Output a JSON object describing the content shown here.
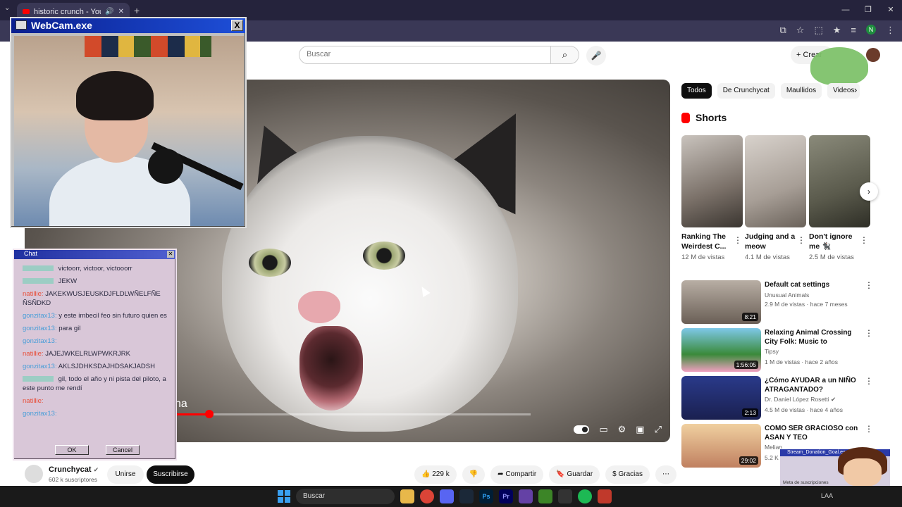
{
  "browser": {
    "tab_title": "historic crunch - YouTube",
    "new_tab": "+",
    "profile_initial": "N"
  },
  "youtube": {
    "search_placeholder": "Buscar",
    "create_label": "Crear",
    "overlay_text": "na",
    "channel": {
      "name": "Crunchycat",
      "subscribers": "602 k suscriptores",
      "join_label": "Unirse",
      "subscribe_label": "Suscribirse"
    },
    "actions": {
      "likes": "229 k",
      "share": "Compartir",
      "save": "Guardar",
      "thanks": "Gracias"
    },
    "chips": [
      "Todos",
      "De Crunchycat",
      "Maullidos",
      "Videos"
    ],
    "shorts_header": "Shorts",
    "shorts": [
      {
        "title": "Ranking The Weirdest C...",
        "views": "12 M de vistas"
      },
      {
        "title": "Judging and a meow",
        "views": "4.1 M de vistas"
      },
      {
        "title": "Don't ignore me 🐈‍⬛",
        "views": "2.5 M de vistas"
      }
    ],
    "recommendations": [
      {
        "title": "Default cat settings",
        "channel": "Unusual Animals",
        "meta": "2.9 M de vistas · hace 7 meses",
        "duration": "8:21"
      },
      {
        "title": "Relaxing Animal Crossing City Folk: Music to study/chill/rela...",
        "channel": "Tipsy",
        "meta": "1 M de vistas · hace 2 años",
        "duration": "1:56:05"
      },
      {
        "title": "¿Cómo AYUDAR a un NIÑO ATRAGANTADO?",
        "channel": "Dr. Daniel López Rosetti",
        "meta": "4.5 M de vistas · hace 4 años",
        "duration": "2:13"
      },
      {
        "title": "COMO SER GRACIOSO con ASAN Y TEO",
        "channel": "Melian",
        "meta": "5.2 K",
        "duration": "29:02"
      }
    ]
  },
  "webcam": {
    "title": "WebCam.exe",
    "close": "X"
  },
  "chat": {
    "title": "Chat",
    "messages": [
      {
        "user": "",
        "text": "victoorr, victoor, victooorr",
        "color": "#5fd3b0"
      },
      {
        "user": "",
        "text": "JEKW",
        "color": "#5fd3b0"
      },
      {
        "user": "natillie:",
        "text": "JAKEKWUSJEUSKDJFLDLWÑELFÑE ÑSÑDKD",
        "color": "#e8503a"
      },
      {
        "user": "gonzitax13:",
        "text": "y este imbecil feo sin futuro quien es",
        "color": "#4a9ed8"
      },
      {
        "user": "gonzitax13:",
        "text": "para gil",
        "color": "#4a9ed8"
      },
      {
        "user": "gonzitax13:",
        "text": "",
        "color": "#4a9ed8"
      },
      {
        "user": "natillie:",
        "text": "JAJEJWKELRLWPWKRJRK",
        "color": "#e8503a"
      },
      {
        "user": "gonzitax13:",
        "text": "AKLSJDHKSDAJHDSAKJADSH",
        "color": "#4a9ed8"
      },
      {
        "user": "",
        "text": "gil, todo el año y ni pista del piloto, a este punto me rendí",
        "color": "#5fd3b0"
      },
      {
        "user": "natillie:",
        "text": "",
        "color": "#e8503a"
      },
      {
        "user": "gonzitax13:",
        "text": "",
        "color": "#4a9ed8"
      }
    ],
    "ok": "OK",
    "cancel": "Cancel"
  },
  "donation": {
    "title": "Stream_Donation_Goal.exe",
    "text": "Meta de suscripciones"
  },
  "taskbar": {
    "search": "Buscar",
    "lang": "LAA"
  },
  "colors": {
    "youtube_red": "#ff0000",
    "browser_chrome": "#3a3856",
    "subscribe_bg": "#0f0f0f"
  }
}
